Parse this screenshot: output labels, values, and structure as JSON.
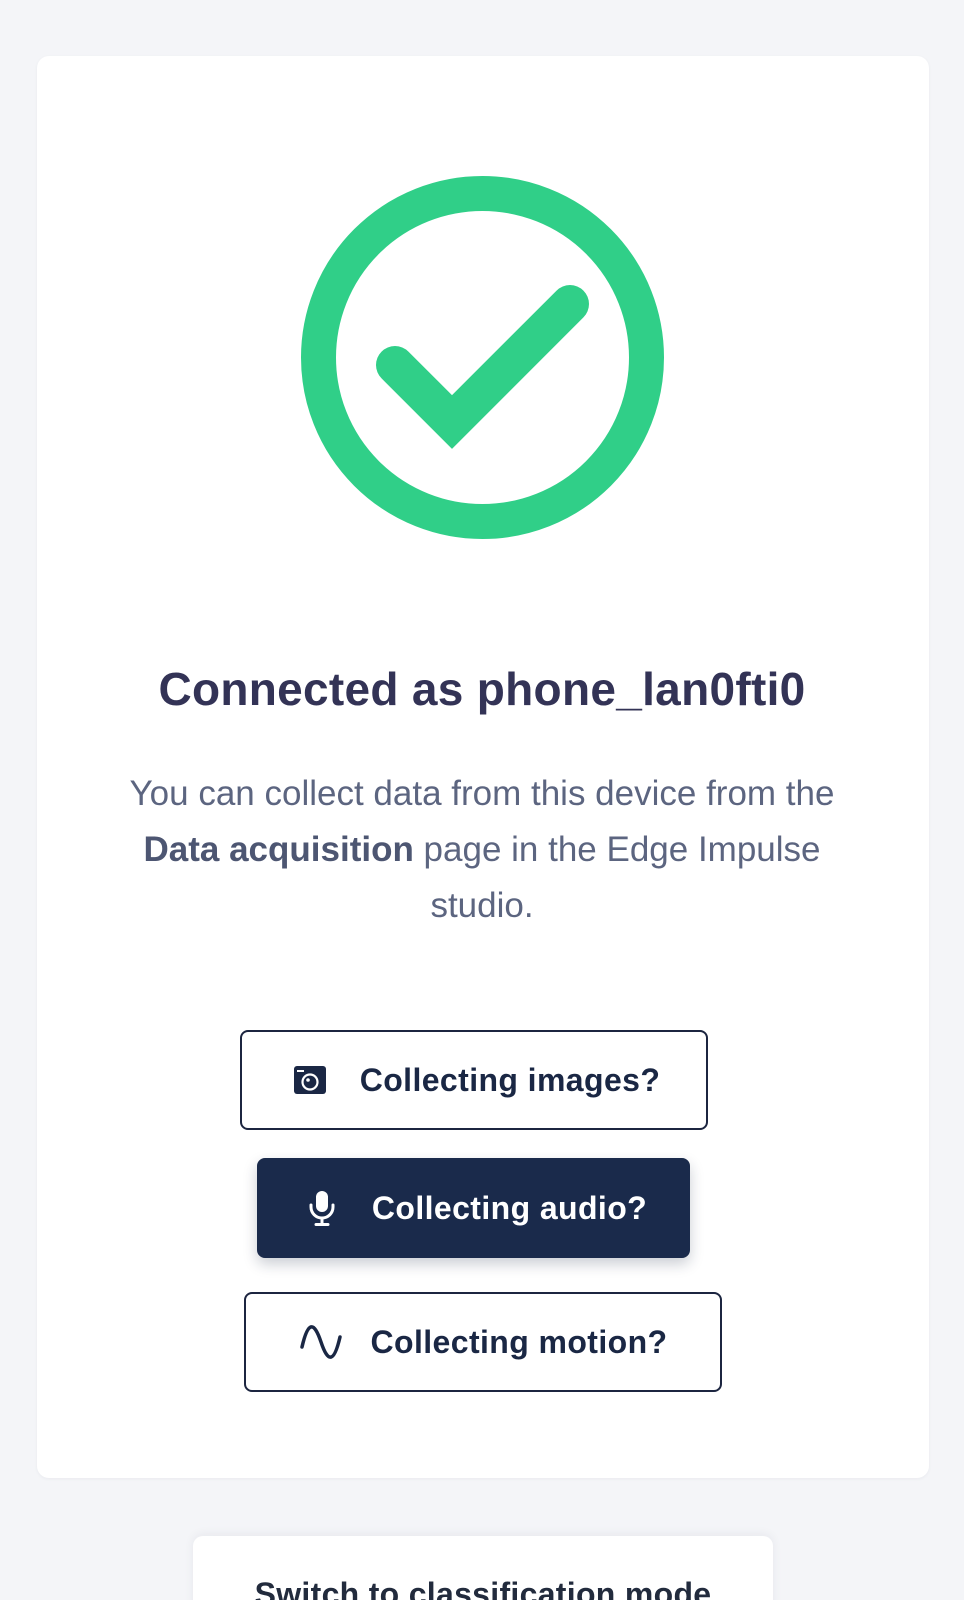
{
  "status": {
    "title": "Connected as phone_lan0fti0",
    "description_before": "You can collect data from this device from the ",
    "description_bold": "Data acquisition",
    "description_after": " page in the Edge Impulse studio.",
    "success_icon": "check-circle-icon",
    "success_color": "#30cf88"
  },
  "buttons": {
    "images": {
      "label": "Collecting images?",
      "icon": "camera-icon"
    },
    "audio": {
      "label": "Collecting audio?",
      "icon": "microphone-icon"
    },
    "motion": {
      "label": "Collecting motion?",
      "icon": "sine-wave-icon"
    }
  },
  "mode": {
    "label": "Switch to classification mode"
  },
  "colors": {
    "background": "#f4f5f8",
    "card": "#ffffff",
    "title_text": "#333356",
    "dark_button": "#1a2a4b"
  }
}
